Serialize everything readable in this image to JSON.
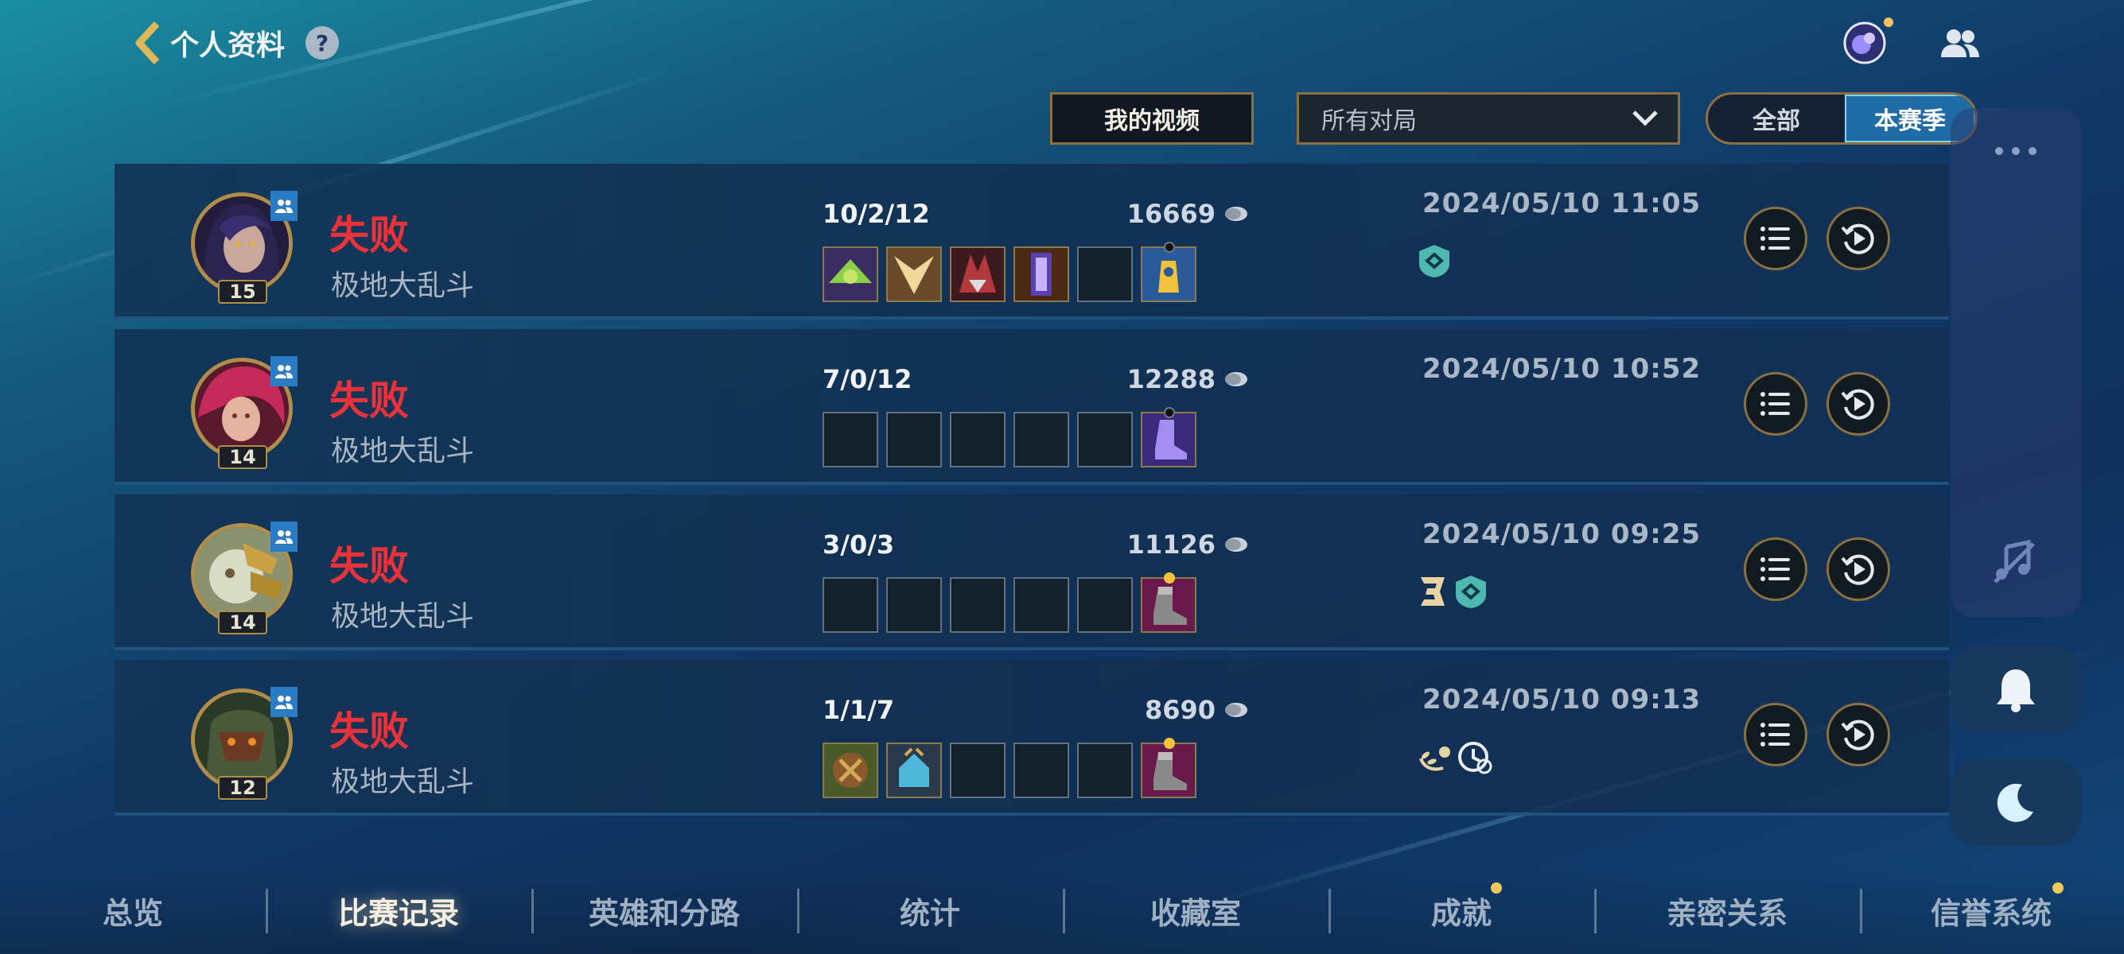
{
  "header": {
    "title": "个人资料",
    "help_label": "?"
  },
  "filters": {
    "my_videos_label": "我的视频",
    "match_type_selected": "所有对局",
    "season_toggle": {
      "all_label": "全部",
      "season_label": "本赛季"
    }
  },
  "matches": [
    {
      "level": "15",
      "result": "失败",
      "mode": "极地大乱斗",
      "kda": "10/2/12",
      "gold": "16669",
      "date": "2024/05/10 11:05",
      "tags": [
        "ward-shield-icon"
      ]
    },
    {
      "level": "14",
      "result": "失败",
      "mode": "极地大乱斗",
      "kda": "7/0/12",
      "gold": "12288",
      "date": "2024/05/10 10:52",
      "tags": []
    },
    {
      "level": "14",
      "result": "失败",
      "mode": "极地大乱斗",
      "kda": "3/0/3",
      "gold": "11126",
      "date": "2024/05/10 09:25",
      "tags": [
        "triple-kill-icon",
        "ward-shield-icon"
      ]
    },
    {
      "level": "12",
      "result": "失败",
      "mode": "极地大乱斗",
      "kda": "1/1/7",
      "gold": "8690",
      "date": "2024/05/10 09:13",
      "tags": [
        "laurel-icon",
        "timer-icon"
      ]
    }
  ],
  "tabs": [
    {
      "label": "总览",
      "active": false
    },
    {
      "label": "比赛记录",
      "active": true
    },
    {
      "label": "英雄和分路",
      "active": false
    },
    {
      "label": "统计",
      "active": false
    },
    {
      "label": "收藏室",
      "active": false
    },
    {
      "label": "成就",
      "active": false,
      "notify": true
    },
    {
      "label": "亲密关系",
      "active": false
    },
    {
      "label": "信誉系统",
      "active": false,
      "notify": true
    }
  ],
  "colors": {
    "loss": "#e8323c",
    "gold_border": "#8a7141",
    "active_toggle": "#1f6ba6"
  }
}
